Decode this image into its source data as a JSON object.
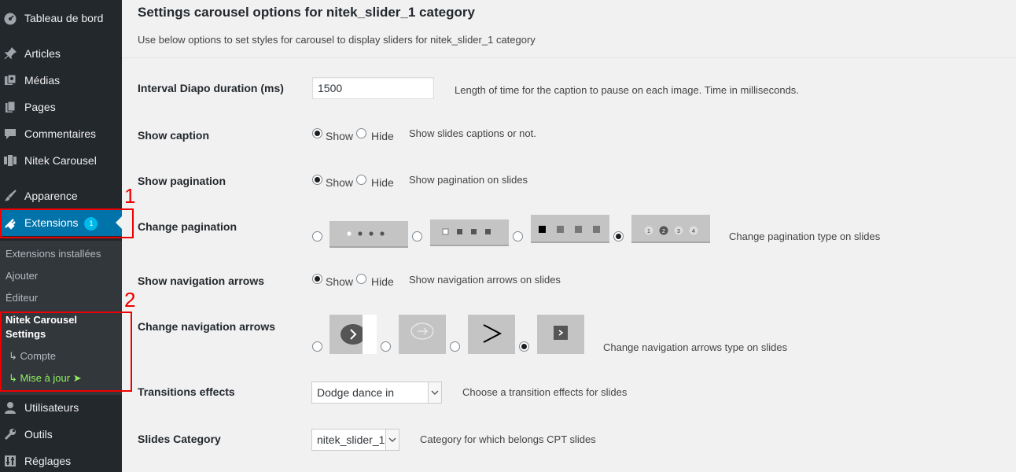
{
  "sidebar": {
    "items": [
      {
        "icon": "dashboard-icon",
        "label": "Tableau de bord"
      },
      {
        "icon": "pin-icon",
        "label": "Articles"
      },
      {
        "icon": "media-icon",
        "label": "Médias"
      },
      {
        "icon": "pages-icon",
        "label": "Pages"
      },
      {
        "icon": "comment-icon",
        "label": "Commentaires"
      },
      {
        "icon": "carousel-icon",
        "label": "Nitek Carousel"
      },
      {
        "icon": "brush-icon",
        "label": "Apparence"
      },
      {
        "icon": "plugin-icon",
        "label": "Extensions",
        "badge": "1"
      },
      {
        "icon": "users-icon",
        "label": "Utilisateurs"
      },
      {
        "icon": "wrench-icon",
        "label": "Outils"
      },
      {
        "icon": "settings-icon",
        "label": "Réglages"
      }
    ],
    "submenu": [
      "Extensions installées",
      "Ajouter",
      "Éditeur",
      "Nitek Carousel Settings",
      "↳ Compte",
      "↳ Mise à jour ➤"
    ]
  },
  "annotations": [
    "1",
    "2"
  ],
  "main": {
    "title": "Settings carousel options for nitek_slider_1 category",
    "description": "Use below options to set styles for carousel to display sliders for nitek_slider_1 category",
    "show_label": "Show",
    "hide_label": "Hide",
    "pagination_numbers": [
      "1",
      "2",
      "3",
      "4"
    ],
    "rows": {
      "interval": {
        "label": "Interval Diapo duration (ms)",
        "value": "1500",
        "hint": "Length of time for the caption to pause on each image. Time in milliseconds."
      },
      "caption": {
        "label": "Show caption",
        "selected": "Show",
        "hint": "Show slides captions or not."
      },
      "pagination": {
        "label": "Show pagination",
        "selected": "Show",
        "hint": "Show pagination on slides"
      },
      "change_pagination": {
        "label": "Change pagination",
        "selected_index": 3,
        "hint": "Change pagination type on slides"
      },
      "nav_arrows": {
        "label": "Show navigation arrows",
        "selected": "Show",
        "hint": "Show navigation arrows on slides"
      },
      "change_arrows": {
        "label": "Change navigation arrows",
        "selected_index": 3,
        "hint": "Change navigation arrows type on slides"
      },
      "transitions": {
        "label": "Transitions effects",
        "value": "Dodge dance in",
        "hint": "Choose a transition effects for slides"
      },
      "category": {
        "label": "Slides Category",
        "value": "nitek_slider_1",
        "hint": "Category for which belongs CPT slides"
      }
    }
  },
  "colors": {
    "sidebar_bg": "#23282d",
    "active_bg": "#0073aa",
    "badge_bg": "#00b9eb",
    "highlight_red": "#ee0000",
    "update_green": "#8ff15f"
  }
}
